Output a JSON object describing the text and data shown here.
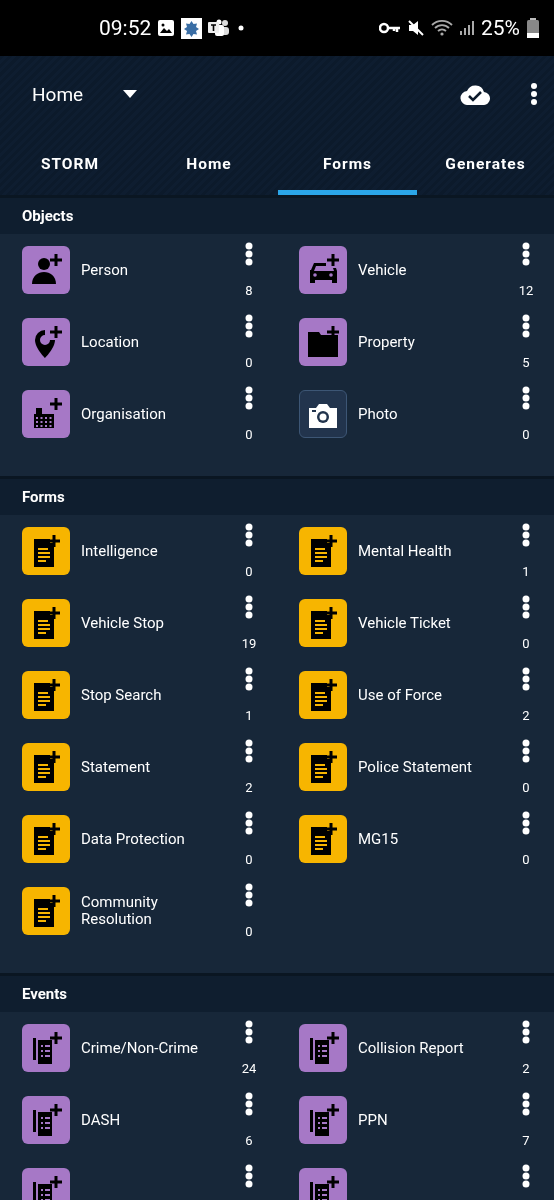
{
  "status_bar": {
    "time": "09:52",
    "battery": "25%"
  },
  "header": {
    "dropdown": "Home"
  },
  "tabs": [
    {
      "label": "STORM",
      "selected": false
    },
    {
      "label": "Home",
      "selected": false
    },
    {
      "label": "Forms",
      "selected": true
    },
    {
      "label": "Generates",
      "selected": false
    }
  ],
  "sections": [
    {
      "title": "Objects",
      "items": [
        {
          "label": "Person",
          "count": "8",
          "kind": "person"
        },
        {
          "label": "Vehicle",
          "count": "12",
          "kind": "vehicle"
        },
        {
          "label": "Location",
          "count": "0",
          "kind": "location"
        },
        {
          "label": "Property",
          "count": "5",
          "kind": "property"
        },
        {
          "label": "Organisation",
          "count": "0",
          "kind": "organisation"
        },
        {
          "label": "Photo",
          "count": "0",
          "kind": "photo"
        }
      ]
    },
    {
      "title": "Forms",
      "items": [
        {
          "label": "Intelligence",
          "count": "0",
          "kind": "form"
        },
        {
          "label": "Mental Health",
          "count": "1",
          "kind": "form"
        },
        {
          "label": "Vehicle Stop",
          "count": "19",
          "kind": "form"
        },
        {
          "label": "Vehicle Ticket",
          "count": "0",
          "kind": "form"
        },
        {
          "label": "Stop Search",
          "count": "1",
          "kind": "form"
        },
        {
          "label": "Use of Force",
          "count": "2",
          "kind": "form"
        },
        {
          "label": "Statement",
          "count": "2",
          "kind": "form"
        },
        {
          "label": "Police Statement",
          "count": "0",
          "kind": "form"
        },
        {
          "label": "Data Protection",
          "count": "0",
          "kind": "form"
        },
        {
          "label": "MG15",
          "count": "0",
          "kind": "form"
        },
        {
          "label": "Community Resolution",
          "count": "0",
          "kind": "form"
        }
      ]
    },
    {
      "title": "Events",
      "items": [
        {
          "label": "Crime/Non-Crime",
          "count": "24",
          "kind": "event"
        },
        {
          "label": "Collision Report",
          "count": "2",
          "kind": "event"
        },
        {
          "label": "DASH",
          "count": "6",
          "kind": "event"
        },
        {
          "label": "PPN",
          "count": "7",
          "kind": "event"
        },
        {
          "kind": "event"
        },
        {
          "kind": "event"
        }
      ]
    }
  ]
}
